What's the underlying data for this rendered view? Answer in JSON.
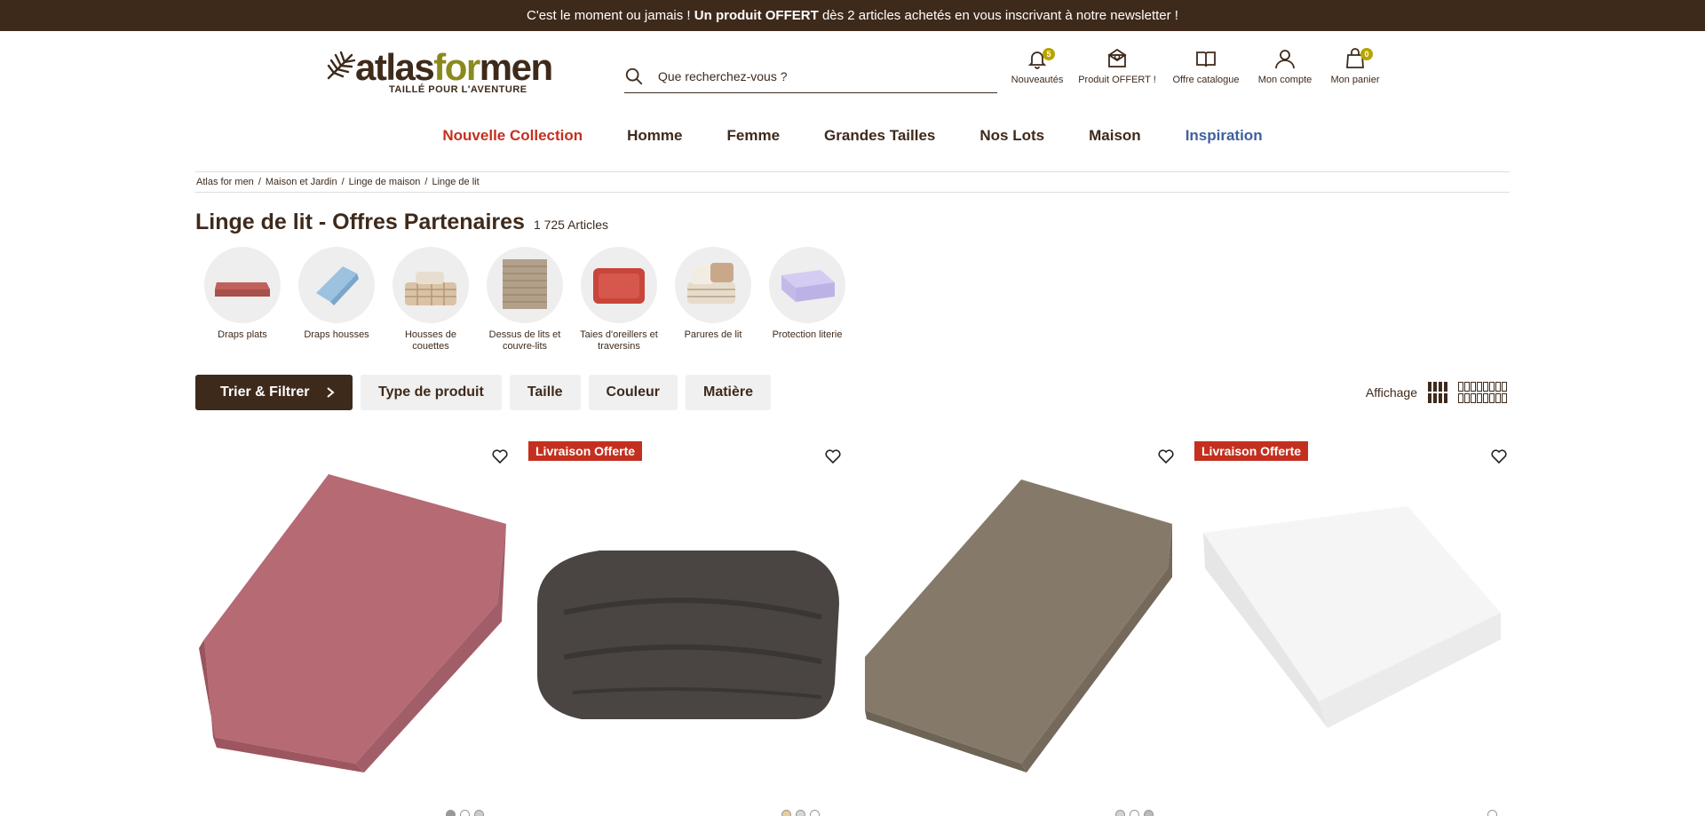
{
  "promo": {
    "part1": "C'est le moment ou jamais !",
    "part2": "Un produit OFFERT",
    "part3": "dès 2 articles achetés en vous inscrivant à notre newsletter !"
  },
  "logo": {
    "brand_a": "atlas",
    "brand_b": "for",
    "brand_c": "men",
    "tagline": "TAILLÉ POUR L'AVENTURE"
  },
  "search": {
    "placeholder": "Que recherchez-vous ?"
  },
  "header_icons": [
    {
      "label": "Nouveautés",
      "icon": "bell-icon",
      "badge": "5"
    },
    {
      "label": "Produit OFFERT !",
      "icon": "gift-mail-icon"
    },
    {
      "label": "Offre catalogue",
      "icon": "book-icon"
    },
    {
      "label": "Mon compte",
      "icon": "user-icon"
    },
    {
      "label": "Mon panier",
      "icon": "bag-icon",
      "badge": "0"
    }
  ],
  "nav": [
    {
      "label": "Nouvelle Collection",
      "color": "#c4301f"
    },
    {
      "label": "Homme"
    },
    {
      "label": "Femme"
    },
    {
      "label": "Grandes Tailles"
    },
    {
      "label": "Nos Lots"
    },
    {
      "label": "Maison"
    },
    {
      "label": "Inspiration",
      "color": "#3f5f9e"
    }
  ],
  "breadcrumb": [
    "Atlas for men",
    "Maison et Jardin",
    "Linge de maison",
    "Linge de lit"
  ],
  "page": {
    "title": "Linge de lit - Offres Partenaires",
    "count": "1 725 Articles"
  },
  "categories": [
    {
      "label": "Draps plats"
    },
    {
      "label": "Draps housses"
    },
    {
      "label": "Housses de couettes"
    },
    {
      "label": "Dessus de lits et couvre-lits"
    },
    {
      "label": "Taies d'oreillers et traversins"
    },
    {
      "label": "Parures de lit"
    },
    {
      "label": "Protection literie"
    }
  ],
  "filters": {
    "main": "Trier & Filtrer",
    "chips": [
      "Type de produit",
      "Taille",
      "Couleur",
      "Matière"
    ]
  },
  "display": {
    "label": "Affichage"
  },
  "products": [
    {
      "badge": "",
      "color": "#b66a73"
    },
    {
      "badge": "Livraison Offerte",
      "color": "#4a4543"
    },
    {
      "badge": "",
      "color": "#857a6a"
    },
    {
      "badge": "Livraison Offerte",
      "color": "#f4f4f4"
    }
  ],
  "colors": {
    "brown": "#3e2a1b",
    "red": "#c4301f",
    "olive": "#8a8a1c",
    "badge": "#b8a400"
  }
}
